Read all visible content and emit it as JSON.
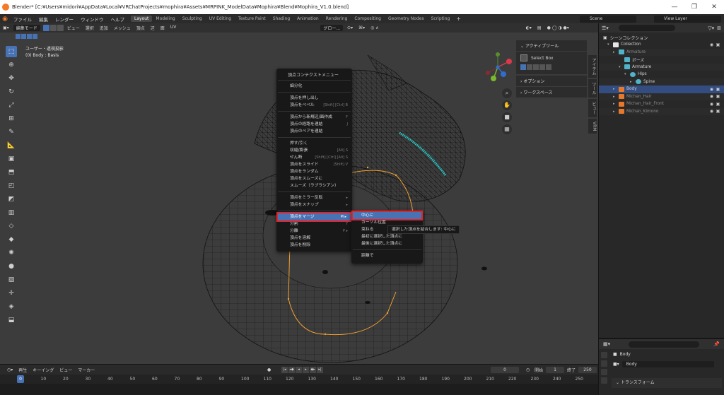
{
  "window": {
    "title": "Blender* [C:¥Users¥midori¥AppData¥Local¥VRChatProjects¥mophira¥Assets¥MRPINK_ModelData¥Mophira¥Blend¥Mophira_V1.0.blend]",
    "minimize": "—",
    "maximize": "❐",
    "close": "✕"
  },
  "menubar": {
    "items": [
      "ファイル",
      "編集",
      "レンダー",
      "ウィンドウ",
      "ヘルプ"
    ],
    "workspaces": [
      "Layout",
      "Modeling",
      "Sculpting",
      "UV Editing",
      "Texture Paint",
      "Shading",
      "Animation",
      "Rendering",
      "Compositing",
      "Geometry Nodes",
      "Scripting"
    ],
    "active_workspace": "Layout",
    "add_label": "+",
    "scene": "Scene",
    "view_layer": "View Layer"
  },
  "viewport_header": {
    "mode": "編集モード",
    "menus": [
      "ビュー",
      "選択",
      "追加",
      "メッシュ",
      "頂点",
      "辺",
      "面",
      "UV"
    ],
    "orientation": "グロー...",
    "options": "オプション"
  },
  "viewport_info": {
    "line1": "ユーザー・透視投影",
    "line2": "(0) Body : Basis"
  },
  "n_panel": {
    "active_tool": "アクティブツール",
    "select_box": "Select Box",
    "options": "オプション",
    "workspace": "ワークスペース",
    "side_tabs": [
      "アイテム",
      "ツール",
      "ビュー",
      "VRM"
    ]
  },
  "context_menu": {
    "title": "頂点コンテクストメニュー",
    "groups": [
      [
        {
          "label": "細分化",
          "shortcut": ""
        }
      ],
      [
        {
          "label": "頂点を押し出し",
          "shortcut": ""
        },
        {
          "label": "頂点をベベル",
          "shortcut": "[Shift] [Ctrl] B"
        }
      ],
      [
        {
          "label": "頂点から新規辺/面作成",
          "shortcut": "F"
        },
        {
          "label": "頂点の経路を連結",
          "shortcut": "J"
        },
        {
          "label": "頂点のペアを連結",
          "shortcut": ""
        }
      ],
      [
        {
          "label": "押す/引く",
          "shortcut": ""
        },
        {
          "label": "収縮/膨張",
          "shortcut": "[Alt] S"
        },
        {
          "label": "せん断",
          "shortcut": "[Shift] [Ctrl] [Alt] S"
        },
        {
          "label": "頂点をスライド",
          "shortcut": "[Shift] V"
        },
        {
          "label": "頂点をランダム",
          "shortcut": ""
        },
        {
          "label": "頂点をスムーズに",
          "shortcut": ""
        },
        {
          "label": "スムーズ（ラプラシアン）",
          "shortcut": ""
        }
      ],
      [
        {
          "label": "頂点をミラー反転",
          "shortcut": "▸"
        },
        {
          "label": "頂点をスナップ",
          "shortcut": "▸"
        }
      ],
      [
        {
          "label": "頂点をマージ",
          "shortcut": "M ▸",
          "highlight": true
        },
        {
          "label": "分割",
          "shortcut": "Y"
        },
        {
          "label": "分離",
          "shortcut": "P ▸"
        },
        {
          "label": "頂点を溶解",
          "shortcut": ""
        },
        {
          "label": "頂点を削除",
          "shortcut": ""
        }
      ]
    ]
  },
  "merge_submenu": {
    "items": [
      {
        "label": "中心に",
        "highlight": true
      },
      {
        "label": "カーソル位置",
        "highlight": false
      },
      {
        "label": "束ねる",
        "highlight": false
      },
      {
        "label": "最初に選択した頂点に",
        "highlight": false
      },
      {
        "label": "最後に選択した頂点に",
        "highlight": false
      },
      {
        "label": "距離で",
        "highlight": false
      }
    ],
    "tooltip": "選択した頂点を結合します: 中心に"
  },
  "outliner": {
    "title": "シーンコレクション",
    "rows": [
      {
        "label": "Collection",
        "indent": 1,
        "arrow": "▾",
        "icon": "collection",
        "dim": false,
        "sel": false
      },
      {
        "label": "Armature",
        "indent": 2,
        "arrow": "▸",
        "icon": "armature",
        "dim": true,
        "sel": false
      },
      {
        "label": "ポーズ",
        "indent": 3,
        "arrow": "",
        "icon": "pose",
        "dim": false,
        "sel": false
      },
      {
        "label": "Armature",
        "indent": 3,
        "arrow": "▾",
        "icon": "armature",
        "dim": false,
        "sel": false
      },
      {
        "label": "Hips",
        "indent": 4,
        "arrow": "▾",
        "icon": "bone",
        "dim": false,
        "sel": false
      },
      {
        "label": "Spine",
        "indent": 5,
        "arrow": "▸",
        "icon": "bone",
        "dim": false,
        "sel": false
      },
      {
        "label": "Body",
        "indent": 2,
        "arrow": "▸",
        "icon": "mesh",
        "dim": false,
        "sel": true
      },
      {
        "label": "Michan_Hair",
        "indent": 2,
        "arrow": "▸",
        "icon": "mesh",
        "dim": true,
        "sel": false
      },
      {
        "label": "Michan_Hair_Front",
        "indent": 2,
        "arrow": "▸",
        "icon": "mesh",
        "dim": true,
        "sel": false
      },
      {
        "label": "Michan_Kimono",
        "indent": 2,
        "arrow": "▸",
        "icon": "mesh",
        "dim": true,
        "sel": false
      }
    ]
  },
  "properties": {
    "object_name": "Body",
    "section": "トランスフォーム"
  },
  "timeline": {
    "menus": [
      "再生",
      "キーイング",
      "ビュー",
      "マーカー"
    ],
    "current_frame": "0",
    "start_label": "開始",
    "start": "1",
    "end_label": "終了",
    "end": "250",
    "ruler": [
      "0",
      "10",
      "20",
      "30",
      "40",
      "50",
      "60",
      "70",
      "80",
      "90",
      "100",
      "110",
      "120",
      "130",
      "140",
      "150",
      "160",
      "170",
      "180",
      "190",
      "200",
      "210",
      "220",
      "230",
      "240",
      "250"
    ],
    "cursor": "0"
  },
  "colors": {
    "accent": "#4772b3",
    "highlight_outline": "#e0242c",
    "selected_edges": "#f0a030",
    "wire": "#0a0a0a"
  }
}
